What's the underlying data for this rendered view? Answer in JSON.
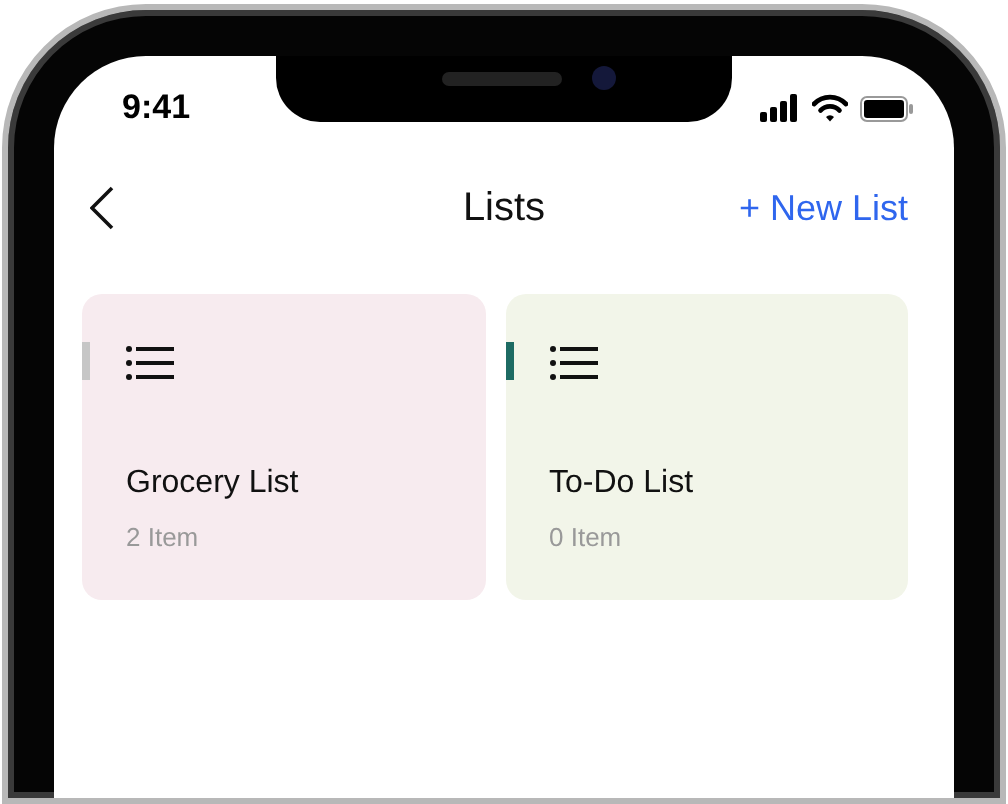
{
  "status_bar": {
    "time": "9:41"
  },
  "nav": {
    "title": "Lists",
    "action": "+ New List"
  },
  "lists": [
    {
      "name": "Grocery List",
      "count": "2 Item",
      "color": "#f7ebef",
      "marker": {
        "color": "#c6c6c6"
      }
    },
    {
      "name": "To-Do List",
      "count": "0 Item",
      "color": "#f2f5e9",
      "marker": {
        "color": "#1d6b63"
      }
    }
  ]
}
